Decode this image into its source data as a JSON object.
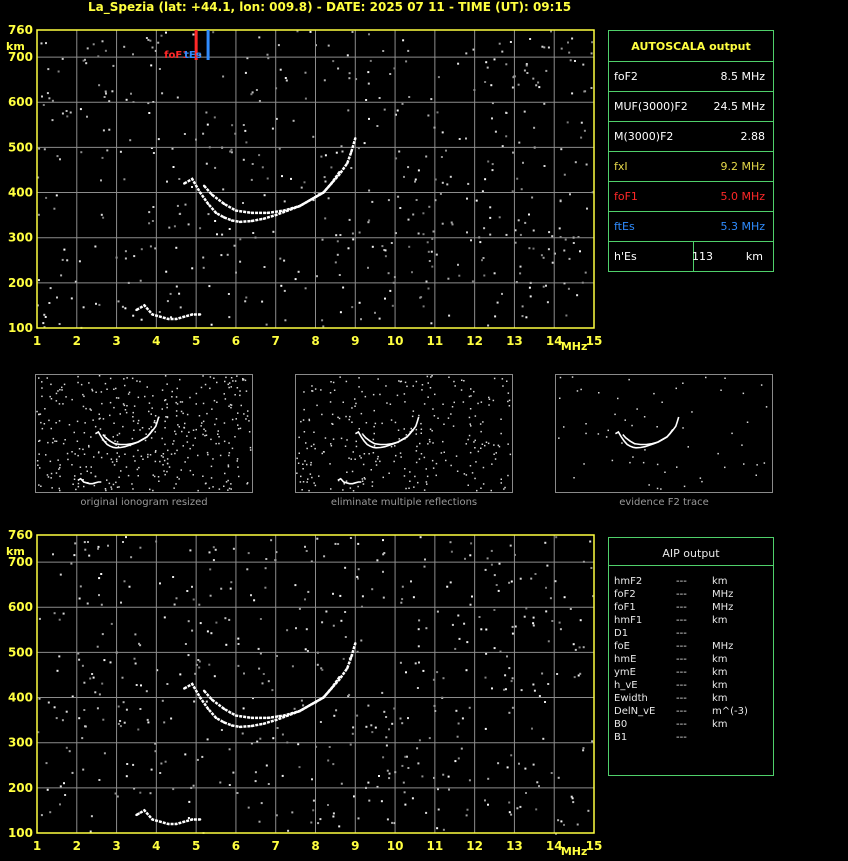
{
  "header": {
    "title": "La_Spezia (lat: +44.1, lon: 009.8) - DATE: 2025 07 11 - TIME (UT): 09:15"
  },
  "colors": {
    "grid": "#8c8c8c",
    "axis": "#ffff40",
    "panel_border": "#4fd06a",
    "fof1": "#ff2828",
    "ftes": "#2f8cff",
    "fxl": "#e6d84a",
    "trace": "#ffffff"
  },
  "chart_data": [
    {
      "type": "scatter",
      "name_id": "ionogram-top",
      "xlabel": "MHz",
      "ylabel": "km",
      "xlim": [
        1,
        15
      ],
      "ylim": [
        100,
        760
      ],
      "x_ticks": [
        1,
        2,
        3,
        4,
        5,
        6,
        7,
        8,
        9,
        10,
        11,
        12,
        13,
        14,
        15
      ],
      "y_ticks": [
        100,
        200,
        300,
        400,
        500,
        600,
        700,
        760
      ],
      "grid": true,
      "markers": {
        "foF1": 5.0,
        "ftEs": 5.3,
        "labels": [
          "foF1",
          "tEs"
        ]
      },
      "series": [
        {
          "role": "o-trace",
          "x": [
            4.7,
            4.9,
            5.1,
            5.3,
            5.5,
            5.7,
            5.9,
            6.1,
            6.4,
            6.7,
            7.0,
            7.3,
            7.6,
            7.9,
            8.2,
            8.4,
            8.6,
            8.8,
            8.9,
            9.0
          ],
          "y": [
            420,
            430,
            400,
            375,
            355,
            345,
            338,
            335,
            337,
            342,
            350,
            360,
            370,
            385,
            400,
            420,
            440,
            465,
            490,
            520
          ]
        },
        {
          "role": "x-trace",
          "x": [
            5.2,
            5.4,
            5.7,
            6.0,
            6.4,
            6.8,
            7.2,
            7.6,
            7.9,
            8.2,
            8.4,
            8.6
          ],
          "y": [
            415,
            395,
            375,
            360,
            355,
            355,
            360,
            370,
            385,
            400,
            420,
            445
          ]
        },
        {
          "role": "E-trace",
          "x": [
            3.5,
            3.7,
            3.9,
            4.1,
            4.3,
            4.5,
            4.7,
            4.9,
            5.1
          ],
          "y": [
            140,
            150,
            130,
            125,
            120,
            120,
            125,
            130,
            130
          ]
        }
      ]
    },
    {
      "type": "scatter",
      "name_id": "ionogram-bottom",
      "xlabel": "MHz",
      "ylabel": "km",
      "xlim": [
        1,
        15
      ],
      "ylim": [
        100,
        760
      ],
      "x_ticks": [
        1,
        2,
        3,
        4,
        5,
        6,
        7,
        8,
        9,
        10,
        11,
        12,
        13,
        14,
        15
      ],
      "y_ticks": [
        100,
        200,
        300,
        400,
        500,
        600,
        700,
        760
      ],
      "grid": true,
      "series": [
        {
          "role": "o-trace",
          "x": [
            4.7,
            4.9,
            5.1,
            5.3,
            5.5,
            5.7,
            5.9,
            6.1,
            6.4,
            6.7,
            7.0,
            7.3,
            7.6,
            7.9,
            8.2,
            8.4,
            8.6,
            8.8,
            8.9,
            9.0
          ],
          "y": [
            420,
            430,
            400,
            375,
            355,
            345,
            338,
            335,
            337,
            342,
            350,
            360,
            370,
            385,
            400,
            420,
            440,
            465,
            490,
            520
          ]
        },
        {
          "role": "x-trace",
          "x": [
            5.2,
            5.4,
            5.7,
            6.0,
            6.4,
            6.8,
            7.2,
            7.6,
            7.9,
            8.2,
            8.4,
            8.6
          ],
          "y": [
            415,
            395,
            375,
            360,
            355,
            355,
            360,
            370,
            385,
            400,
            420,
            445
          ]
        },
        {
          "role": "E-trace",
          "x": [
            3.5,
            3.7,
            3.9,
            4.1,
            4.3,
            4.5,
            4.7,
            4.9,
            5.1
          ],
          "y": [
            140,
            150,
            130,
            125,
            120,
            120,
            125,
            130,
            130
          ]
        }
      ]
    }
  ],
  "autoscala": {
    "title": "AUTOSCALA output",
    "rows": [
      {
        "label": "foF2",
        "value": "8.5 MHz",
        "color": "#ffffff"
      },
      {
        "label": "MUF(3000)F2",
        "value": "24.5 MHz",
        "color": "#ffffff"
      },
      {
        "label": "M(3000)F2",
        "value": "2.88",
        "color": "#ffffff"
      },
      {
        "label": "fxI",
        "value": "9.2 MHz",
        "color": "#e6d84a"
      },
      {
        "label": "foF1",
        "value": "5.0 MHz",
        "color": "#ff2828"
      },
      {
        "label": "ftEs",
        "value": "5.3 MHz",
        "color": "#2f8cff"
      },
      {
        "label": "h'Es",
        "value": "113",
        "unit": "km",
        "color": "#ffffff"
      }
    ]
  },
  "thumbnails": [
    {
      "caption": "original ionogram resized"
    },
    {
      "caption": "eliminate multiple reflections"
    },
    {
      "caption": "evidence F2 trace"
    }
  ],
  "aip": {
    "title": "AIP output",
    "rows": [
      {
        "param": "hmF2",
        "value": "---",
        "unit": "km"
      },
      {
        "param": "foF2",
        "value": "---",
        "unit": "MHz"
      },
      {
        "param": "foF1",
        "value": "---",
        "unit": "MHz"
      },
      {
        "param": "hmF1",
        "value": "---",
        "unit": "km"
      },
      {
        "param": "D1",
        "value": "---",
        "unit": ""
      },
      {
        "param": "foE",
        "value": "---",
        "unit": "MHz"
      },
      {
        "param": "hmE",
        "value": "---",
        "unit": "km"
      },
      {
        "param": "ymE",
        "value": "---",
        "unit": "km"
      },
      {
        "param": "h_vE",
        "value": "---",
        "unit": "km"
      },
      {
        "param": "Ewidth",
        "value": "---",
        "unit": "km"
      },
      {
        "param": "DelN_vE",
        "value": "---",
        "unit": "m^(-3)"
      },
      {
        "param": "B0",
        "value": "---",
        "unit": "km"
      },
      {
        "param": "B1",
        "value": "---",
        "unit": ""
      }
    ]
  }
}
